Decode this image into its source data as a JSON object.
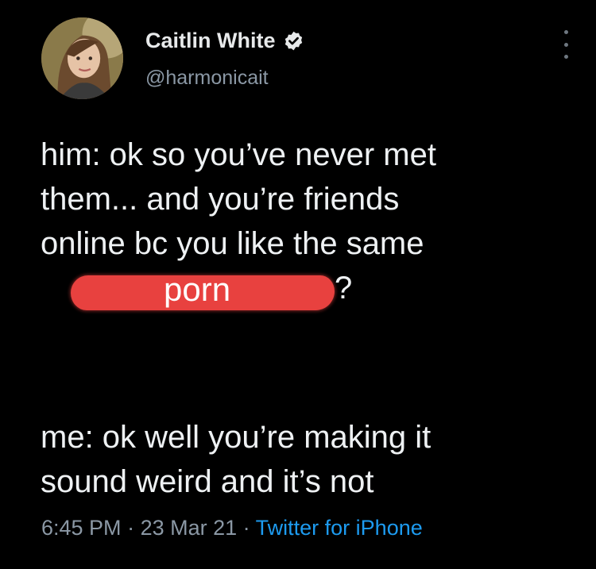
{
  "tweet": {
    "author": {
      "display_name": "Caitlin White",
      "handle": "@harmonicait",
      "verified": true,
      "avatar_icon": "profile-photo"
    },
    "text_part1": [
      "him: ok so you’ve never met",
      "them... and you’re friends",
      "online bc you like the same"
    ],
    "redacted_overlay_word": "porn",
    "trailing_punct": "?",
    "text_part2": [
      "me: ok well you’re making it",
      "sound weird and it’s not"
    ],
    "meta": {
      "time": "6:45 PM",
      "sep1": " · ",
      "date": "23 Mar 21",
      "sep2": " · ",
      "source": "Twitter for iPhone"
    }
  },
  "colors": {
    "background": "#000000",
    "text": "#eef1f3",
    "secondary": "#8b98a5",
    "link": "#1d9bf0",
    "redaction": "#e8413f"
  }
}
